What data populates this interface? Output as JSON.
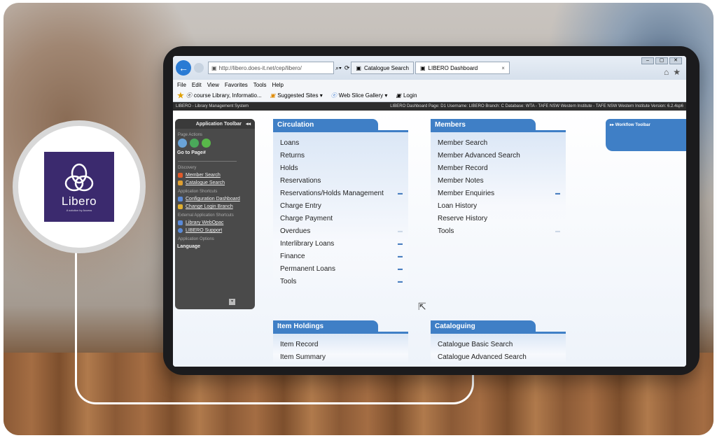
{
  "logo": {
    "name": "Libero",
    "tagline": "A solution by Access"
  },
  "browser": {
    "address": "http://libero.does-it.net/cep/libero/",
    "tabs": [
      {
        "label": "Catalogue Search",
        "active": false
      },
      {
        "label": "LIBERO Dashboard",
        "active": true,
        "close": "×"
      }
    ],
    "menu": [
      "File",
      "Edit",
      "View",
      "Favorites",
      "Tools",
      "Help"
    ],
    "favorites": [
      "course Library, Informatio...",
      "Suggested Sites ▾",
      "Web Slice Gallery ▾",
      "Login"
    ]
  },
  "system_bar": {
    "left": "LIBERO - Library Management System",
    "right": "LIBERO Dashboard  Page: D1  Username: LIBERO  Branch: C  Database: WTA - TAFE NSW Western Institute - TAFE NSW Western Institute  Version: 6.2.4sp6"
  },
  "app_toolbar": {
    "title": "Application Toolbar",
    "collapse": "◂◂",
    "page_actions": "Page Actions",
    "goto_page": "Go to Page#",
    "discovery": "Discovery",
    "discovery_links": [
      "Member Search",
      "Catalogue Search"
    ],
    "shortcuts": "Application Shortcuts",
    "shortcut_links": [
      "Configuration Dashboard",
      "Change Login Branch"
    ],
    "external": "External Application Shortcuts",
    "external_links": [
      "Library WebOpac",
      "LIBERO Support"
    ],
    "options": "Application Options",
    "language": "Language"
  },
  "circulation": {
    "title": "Circulation",
    "items": [
      "Loans",
      "Returns",
      "Holds",
      "Reservations",
      "Reservations/Holds Management",
      "Charge Entry",
      "Charge Payment",
      "Overdues",
      "Interlibrary Loans",
      "Finance",
      "Permanent Loans",
      "Tools"
    ],
    "arrows": [
      false,
      false,
      false,
      false,
      true,
      false,
      false,
      "dim",
      true,
      true,
      true,
      true
    ]
  },
  "members": {
    "title": "Members",
    "items": [
      "Member Search",
      "Member Advanced Search",
      "Member Record",
      "Member Notes",
      "Member Enquiries",
      "Loan History",
      "Reserve History",
      "Tools"
    ],
    "arrows": [
      false,
      false,
      false,
      false,
      true,
      false,
      false,
      "dim"
    ]
  },
  "item_holdings": {
    "title": "Item Holdings",
    "items": [
      "Item Record",
      "Item Summary"
    ]
  },
  "cataloguing": {
    "title": "Cataloguing",
    "items": [
      "Catalogue Basic Search",
      "Catalogue Advanced Search"
    ]
  },
  "workflow_toolbar": {
    "title": "Workflow Toolbar",
    "expand": "▸▸"
  },
  "colors": {
    "accent": "#3f7fc6",
    "logo_bg": "#3b2a6e",
    "toolbar_bg": "#4a4a4a"
  }
}
